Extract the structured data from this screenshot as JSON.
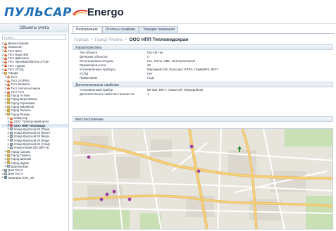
{
  "header": {
    "logo_text": "ПУЛЬСАР",
    "app_title": "Energo"
  },
  "left_panel": {
    "title": "Объекты учета",
    "search_placeholder": "Поиск...",
    "tree": [
      {
        "label": "Демонстрация",
        "expander": "⊞",
        "icon": "person",
        "indent": 0
      },
      {
        "label": "Казахстан",
        "expander": "⊞",
        "icon": "person",
        "indent": 0
      },
      {
        "label": "Тест Вите",
        "expander": "⊞",
        "icon": "person",
        "indent": 0
      },
      {
        "label": "Тест Вода 485",
        "expander": "⊞",
        "icon": "person",
        "indent": 0
      },
      {
        "label": "Тест Давление",
        "expander": "⊞",
        "icon": "person",
        "indent": 0
      },
      {
        "label": "Тест преобразователь Л-Горт",
        "expander": "⊞",
        "icon": "person",
        "indent": 0
      },
      {
        "label": "Тест тура26",
        "expander": "⊞",
        "icon": "person",
        "indent": 0
      },
      {
        "label": "Тест УСПД",
        "expander": "⊞",
        "icon": "person",
        "indent": 0
      },
      {
        "label": "Города",
        "expander": "⊟",
        "icon": "folder",
        "indent": 0
      },
      {
        "label": "Тест",
        "expander": "⊞",
        "icon": "person",
        "indent": 1
      },
      {
        "label": "Тест 2-GPRS",
        "expander": "⊞",
        "icon": "person",
        "indent": 1
      },
      {
        "label": "Тест Калмета",
        "expander": "⊞",
        "icon": "person",
        "indent": 1
      },
      {
        "label": "Тест теплосчетчиков",
        "expander": "⊞",
        "icon": "person",
        "indent": 1
      },
      {
        "label": "Тест ТСЧ",
        "expander": "⊞",
        "icon": "person",
        "indent": 1
      },
      {
        "label": "Город Астана",
        "expander": "⊞",
        "icon": "folder",
        "indent": 1
      },
      {
        "label": "Город Воронежник",
        "expander": "⊞",
        "icon": "folder",
        "indent": 1
      },
      {
        "label": "Город Коряжмаш",
        "expander": "⊞",
        "icon": "folder",
        "indent": 1
      },
      {
        "label": "Город Михайлов",
        "expander": "⊞",
        "icon": "folder",
        "indent": 1
      },
      {
        "label": "Город Рыбное",
        "expander": "⊞",
        "icon": "folder",
        "indent": 1
      },
      {
        "label": "Город Рязань",
        "expander": "⊟",
        "icon": "folder",
        "indent": 1
      },
      {
        "label": "Коммутор",
        "expander": "⊞",
        "icon": "person",
        "indent": 2
      },
      {
        "label": "ООО \"Электроприбор-Ко",
        "expander": "⊞",
        "icon": "person",
        "indent": 2
      },
      {
        "label": "ООО НПП Тепловодо",
        "expander": "⊞",
        "icon": "dev",
        "indent": 2,
        "selected": true
      },
      {
        "label": "Улица Крупской 26 (Тамм",
        "expander": "⊞",
        "icon": "house",
        "indent": 2
      },
      {
        "label": "Улица Крупской 26 (Мерт)",
        "expander": "⊞",
        "icon": "house",
        "indent": 2
      },
      {
        "label": "Улица Крупской 26 (Мерк",
        "expander": "⊞",
        "icon": "house",
        "indent": 2
      },
      {
        "label": "Улица Крупской 26 (Роди",
        "expander": "⊞",
        "icon": "house",
        "indent": 2
      },
      {
        "label": "Улица Крупской 26 (Альф",
        "expander": "⊞",
        "icon": "house",
        "indent": 2
      },
      {
        "label": "Улица Новая 53а (ВКТ-5)",
        "expander": "⊞",
        "icon": "house",
        "indent": 2
      },
      {
        "label": "Город Сасово",
        "expander": "⊞",
        "icon": "folder",
        "indent": 1
      },
      {
        "label": "Город Тюмень",
        "expander": "⊞",
        "icon": "folder",
        "indent": 1
      },
      {
        "label": "Город Шилово",
        "expander": "⊞",
        "icon": "folder",
        "indent": 1
      },
      {
        "label": "Город Щурок",
        "expander": "⊞",
        "icon": "folder",
        "indent": 1
      },
      {
        "label": "Дом Велком",
        "expander": "⊞",
        "icon": "house",
        "indent": 1
      },
      {
        "label": "Дом Тест2",
        "expander": "⊞",
        "icon": "house",
        "indent": 0
      },
      {
        "label": "Дом Тест3",
        "expander": "⊞",
        "icon": "house",
        "indent": 0
      },
      {
        "label": "Квартира НЛО_WI",
        "expander": "⊞",
        "icon": "meter",
        "indent": 0
      }
    ]
  },
  "tabs": [
    {
      "label": "Информация",
      "active": true
    },
    {
      "label": "Отчеты и графики",
      "active": false
    },
    {
      "label": "Текущие показания",
      "active": false
    }
  ],
  "breadcrumb": {
    "items": [
      "Города",
      "Город Рязань"
    ],
    "separator": "»",
    "current": "ООО НПП Тепловодохран"
  },
  "sections": {
    "characteristics": {
      "title": "Характеристика",
      "rows": [
        {
          "key": "Тип объекта",
          "value": "Пустой тип"
        },
        {
          "key": "Дочерних объектов",
          "value": "0"
        },
        {
          "key": "Используемые ресурсы",
          "value": "Газ, Тепло, ХВС, Электроэнергия"
        },
        {
          "key": "Параметров учета",
          "value": "25"
        },
        {
          "key": "Установленные приборы",
          "value": "Меркурий-236, Пульсар2 GPRS, Гамма3R2, ВКТ7"
        },
        {
          "key": "УСПД",
          "value": "Нет"
        },
        {
          "key": "Примечание",
          "value": "НСД"
        }
      ]
    },
    "extra": {
      "title": "Дополнительные свойства",
      "rows": [
        {
          "key": "Установленный прибор",
          "value": "ВК-625; ВКТ7; Гамма 3R; Меркурий230"
        },
        {
          "key": "Дополнительное свойство типа места",
          "value": "1"
        }
      ]
    },
    "location": {
      "title": "Местоположение"
    }
  },
  "colors": {
    "brand_blue": "#1e6fb8",
    "marker_purple": "#9b3fa6",
    "marker_green": "#2f8a3a",
    "road_yellow": "#f3d27a",
    "road_orange": "#eab766"
  }
}
